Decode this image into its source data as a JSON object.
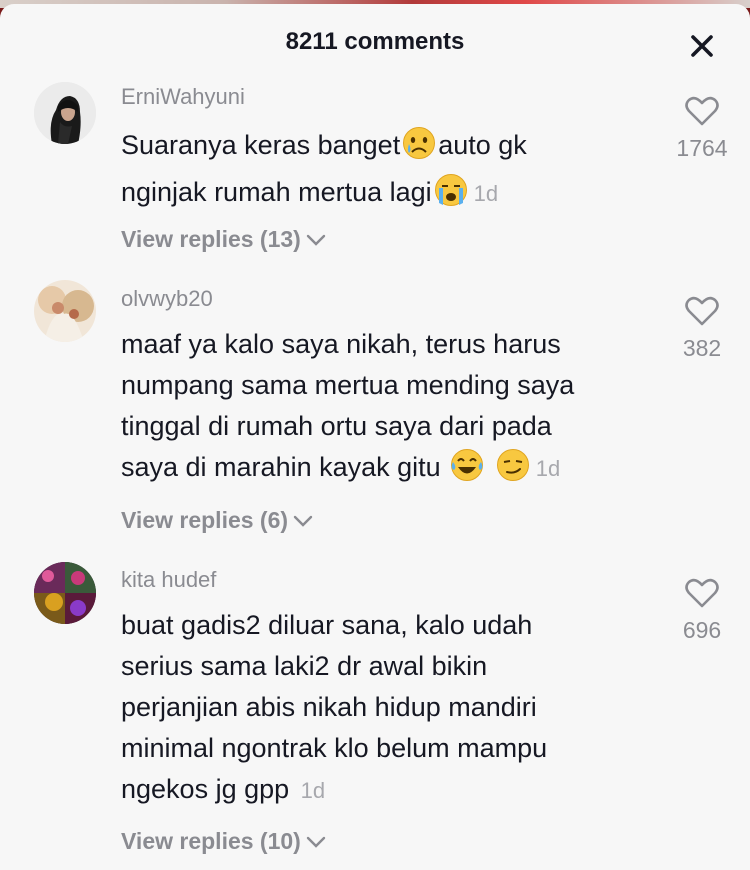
{
  "header": {
    "title": "8211 comments",
    "close_icon": "close-icon"
  },
  "comments": [
    {
      "username": "ErniWahyuni",
      "text_1": "Suaranya keras banget",
      "text_2": "auto gk",
      "text_3": "nginjak rumah mertua lagi",
      "time": "1d",
      "emojis": [
        "crying-face",
        "loudly-crying-face"
      ],
      "likes": "1764",
      "replies": "View replies (13)"
    },
    {
      "username": "olvwyb20",
      "lines": [
        "maaf ya kalo saya nikah, terus harus",
        "numpang sama mertua mending saya",
        "tinggal di rumah ortu saya dari pada",
        "saya di marahin kayak gitu"
      ],
      "time": "1d",
      "emojis": [
        "tears-of-joy",
        "smirking-face"
      ],
      "likes": "382",
      "replies": "View replies (6)"
    },
    {
      "username": "kita hudef",
      "lines": [
        "buat gadis2 diluar sana, kalo udah",
        "serius sama laki2 dr awal bikin",
        "perjanjian abis nikah hidup mandiri",
        "minimal ngontrak klo belum mampu",
        "ngekos jg gpp"
      ],
      "time": "1d",
      "likes": "696",
      "replies": "View replies (10)"
    }
  ],
  "colors": {
    "text": "#161823",
    "muted": "#8a8b91",
    "background": "#f7f7f7"
  }
}
